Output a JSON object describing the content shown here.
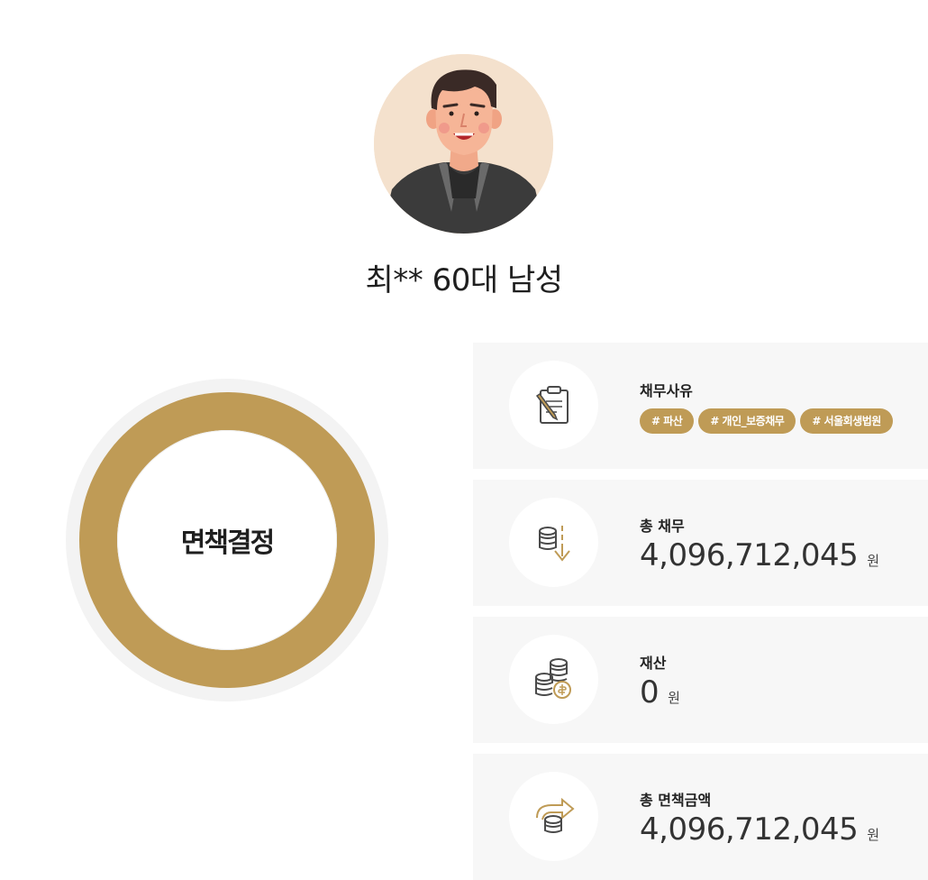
{
  "profile": {
    "name": "최** 60대 남성"
  },
  "result": {
    "label": "면책결정"
  },
  "cards": [
    {
      "icon": "clipboard-pencil-icon",
      "title": "채무사유",
      "tags": [
        "# 파산",
        "# 개인_보증채무",
        "# 서울회생법원"
      ]
    },
    {
      "icon": "coins-down-arrow-icon",
      "title": "총 채무",
      "value": "4,096,712,045",
      "unit": "원"
    },
    {
      "icon": "coin-stacks-icon",
      "title": "재산",
      "value": "0",
      "unit": "원"
    },
    {
      "icon": "coins-arrow-icon",
      "title": "총 면책금액",
      "value": "4,096,712,045",
      "unit": "원"
    }
  ],
  "colors": {
    "accent": "#bf9b56",
    "card_bg": "#f7f7f7",
    "avatar_bg": "#f4e1cd"
  }
}
